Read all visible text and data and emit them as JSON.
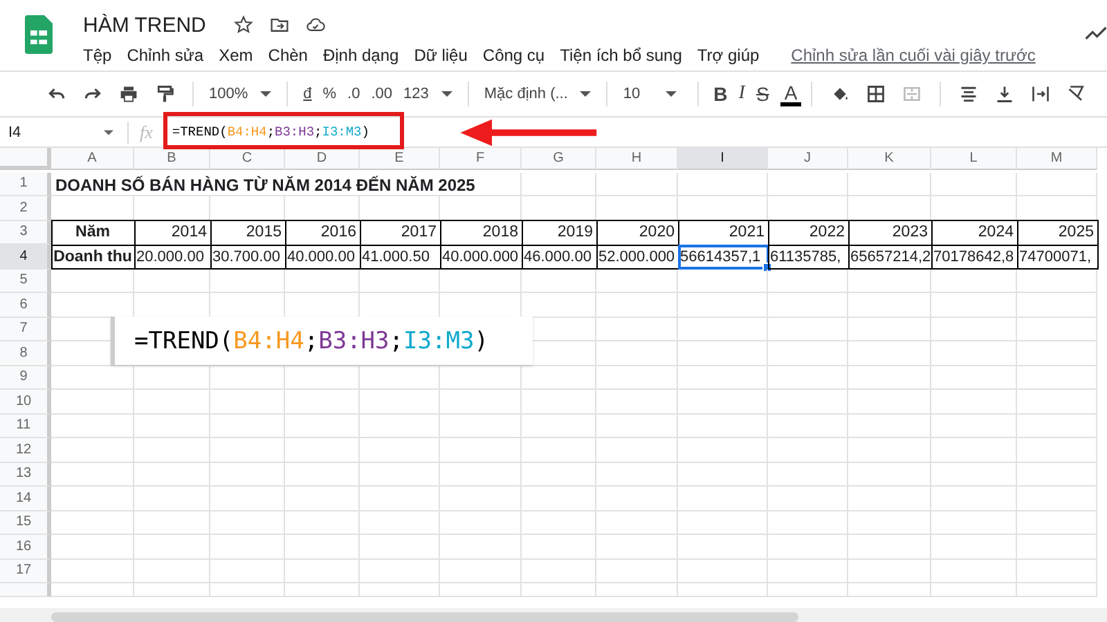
{
  "document": {
    "title": "HÀM TREND",
    "last_edit": "Chỉnh sửa lần cuối vài giây trước"
  },
  "menu": [
    "Tệp",
    "Chỉnh sửa",
    "Xem",
    "Chèn",
    "Định dạng",
    "Dữ liệu",
    "Công cụ",
    "Tiện ích bổ sung",
    "Trợ giúp"
  ],
  "toolbar": {
    "zoom": "100%",
    "currency": "đ",
    "percent": "%",
    "decrease_decimal": ".0",
    "increase_decimal": ".00",
    "number_format": "123",
    "font": "Mặc định (...",
    "font_size": "10",
    "bold": "B",
    "italic": "I",
    "strikethrough": "S",
    "text_color": "A"
  },
  "formula_bar": {
    "name_box": "I4",
    "function_label": "fx",
    "formula": [
      {
        "text": "=TREND(",
        "color": "#000000"
      },
      {
        "text": "B4:H4",
        "color": "#f7981d"
      },
      {
        "text": ";",
        "color": "#000000"
      },
      {
        "text": "B3:H3",
        "color": "#7e3794"
      },
      {
        "text": ";",
        "color": "#000000"
      },
      {
        "text": "I3:M3",
        "color": "#11a9cc"
      },
      {
        "text": ")",
        "color": "#000000"
      }
    ]
  },
  "sheet": {
    "columns": [
      {
        "label": "A",
        "selected": false
      },
      {
        "label": "B",
        "selected": false
      },
      {
        "label": "C",
        "selected": false
      },
      {
        "label": "D",
        "selected": false
      },
      {
        "label": "E",
        "selected": false
      },
      {
        "label": "F",
        "selected": false
      },
      {
        "label": "G",
        "selected": false
      },
      {
        "label": "H",
        "selected": false
      },
      {
        "label": "I",
        "selected": true
      },
      {
        "label": "J",
        "selected": false
      },
      {
        "label": "K",
        "selected": false
      },
      {
        "label": "L",
        "selected": false
      },
      {
        "label": "M",
        "selected": false
      }
    ],
    "rows": [
      {
        "number": "1",
        "selected": false,
        "kind": "title",
        "text": "DOANH SỐ BÁN HÀNG TỪ NĂM 2014 ĐẾN NĂM 2025"
      },
      {
        "number": "2",
        "selected": false,
        "kind": "empty"
      },
      {
        "number": "3",
        "selected": false,
        "kind": "table",
        "cells": [
          {
            "text": "Năm",
            "selected": false
          },
          {
            "text": "2014",
            "selected": false
          },
          {
            "text": "2015",
            "selected": false
          },
          {
            "text": "2016",
            "selected": false
          },
          {
            "text": "2017",
            "selected": false
          },
          {
            "text": "2018",
            "selected": false
          },
          {
            "text": "2019",
            "selected": false
          },
          {
            "text": "2020",
            "selected": false
          },
          {
            "text": "2021",
            "selected": false
          },
          {
            "text": "2022",
            "selected": false
          },
          {
            "text": "2023",
            "selected": false
          },
          {
            "text": "2024",
            "selected": false
          },
          {
            "text": "2025",
            "selected": false
          }
        ]
      },
      {
        "number": "4",
        "selected": true,
        "kind": "table",
        "cells": [
          {
            "text": "Doanh thu",
            "selected": false
          },
          {
            "text": "20.000.00",
            "selected": false
          },
          {
            "text": "30.700.00",
            "selected": false
          },
          {
            "text": "40.000.00",
            "selected": false
          },
          {
            "text": "41.000.50",
            "selected": false
          },
          {
            "text": "40.000.000",
            "selected": false
          },
          {
            "text": "46.000.00",
            "selected": false
          },
          {
            "text": "52.000.000",
            "selected": false
          },
          {
            "text": "56614357,1",
            "selected": true
          },
          {
            "text": "61135785,",
            "selected": false
          },
          {
            "text": "65657214,2",
            "selected": false
          },
          {
            "text": "70178642,8",
            "selected": false
          },
          {
            "text": "74700071,",
            "selected": false
          }
        ]
      },
      {
        "number": "5",
        "selected": false,
        "kind": "empty"
      },
      {
        "number": "6",
        "selected": false,
        "kind": "empty"
      },
      {
        "number": "7",
        "selected": false,
        "kind": "empty"
      },
      {
        "number": "8",
        "selected": false,
        "kind": "empty"
      },
      {
        "number": "9",
        "selected": false,
        "kind": "empty"
      },
      {
        "number": "10",
        "selected": false,
        "kind": "empty"
      },
      {
        "number": "11",
        "selected": false,
        "kind": "empty"
      },
      {
        "number": "12",
        "selected": false,
        "kind": "empty"
      },
      {
        "number": "13",
        "selected": false,
        "kind": "empty"
      },
      {
        "number": "14",
        "selected": false,
        "kind": "empty"
      },
      {
        "number": "15",
        "selected": false,
        "kind": "empty"
      },
      {
        "number": "16",
        "selected": false,
        "kind": "empty"
      },
      {
        "number": "17",
        "selected": false,
        "kind": "empty"
      }
    ]
  },
  "callout": {
    "formula": [
      {
        "text": "=TREND(",
        "color": "#000000"
      },
      {
        "text": "B4:H4",
        "color": "#f7981d"
      },
      {
        "text": ";",
        "color": "#000000"
      },
      {
        "text": "B3:H3",
        "color": "#7e3794"
      },
      {
        "text": ";",
        "color": "#000000"
      },
      {
        "text": "I3:M3",
        "color": "#11a9cc"
      },
      {
        "text": ")",
        "color": "#000000"
      }
    ]
  }
}
